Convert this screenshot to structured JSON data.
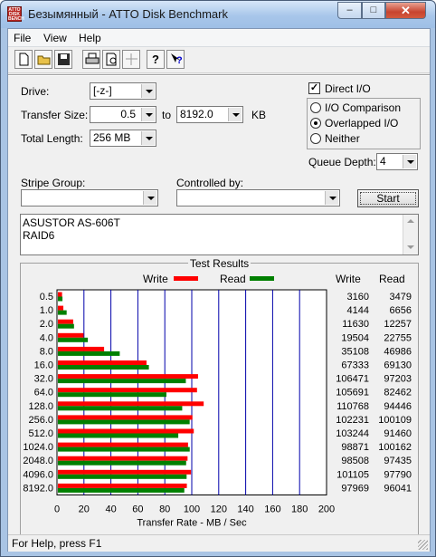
{
  "window": {
    "title": "Безымянный - ATTO Disk Benchmark",
    "icon_text": "ATTO DISK BENCH"
  },
  "menu": [
    "File",
    "View",
    "Help"
  ],
  "toolbar": [
    "new-icon",
    "open-icon",
    "save-icon",
    "print-icon",
    "print-preview-icon",
    "move-icon",
    "help-icon",
    "context-help-icon"
  ],
  "form": {
    "drive_label": "Drive:",
    "drive_value": "[-z-]",
    "transfer_size_label": "Transfer Size:",
    "transfer_size_from": "0.5",
    "transfer_to_label": "to",
    "transfer_size_to": "8192.0",
    "transfer_unit": "KB",
    "total_length_label": "Total Length:",
    "total_length_value": "256 MB",
    "direct_io_label": "Direct I/O",
    "io_comparison_label": "I/O Comparison",
    "overlapped_io_label": "Overlapped I/O",
    "neither_label": "Neither",
    "queue_depth_label": "Queue Depth:",
    "queue_depth_value": "4",
    "stripe_group_label": "Stripe Group:",
    "controlled_by_label": "Controlled by:",
    "start_button": "Start",
    "description_line1": "ASUSTOR AS-606T",
    "description_line2": "RAID6"
  },
  "results": {
    "title": "Test Results",
    "write_legend": "Write",
    "read_legend": "Read",
    "write_col": "Write",
    "read_col": "Read",
    "write_color": "#ff0000",
    "read_color": "#008000"
  },
  "chart_data": {
    "type": "bar",
    "title": "Test Results",
    "xlabel": "Transfer Rate - MB / Sec",
    "xlim": [
      0,
      200
    ],
    "xticks": [
      "0",
      "20",
      "40",
      "60",
      "80",
      "100",
      "120",
      "140",
      "160",
      "180",
      "200"
    ],
    "categories": [
      "0.5",
      "1.0",
      "2.0",
      "4.0",
      "8.0",
      "16.0",
      "32.0",
      "64.0",
      "128.0",
      "256.0",
      "512.0",
      "1024.0",
      "2048.0",
      "4096.0",
      "8192.0"
    ],
    "series": [
      {
        "name": "Write",
        "values": [
          3160,
          4144,
          11630,
          19504,
          35108,
          67333,
          106471,
          105691,
          110768,
          102231,
          103244,
          98871,
          98508,
          101105,
          97969
        ]
      },
      {
        "name": "Read",
        "values": [
          3479,
          6656,
          12257,
          22755,
          46986,
          69130,
          97203,
          82462,
          94446,
          100109,
          91460,
          100162,
          97435,
          97790,
          96041
        ]
      }
    ],
    "grid": true
  },
  "status": "For Help, press F1"
}
